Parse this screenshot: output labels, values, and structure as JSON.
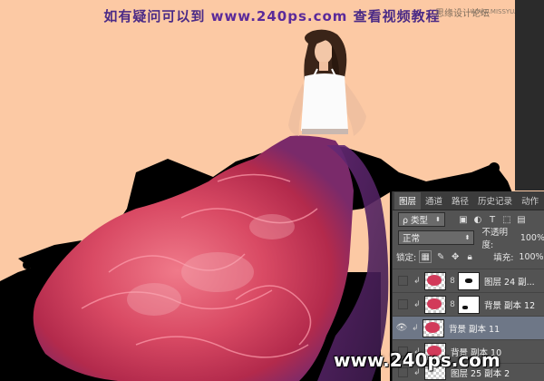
{
  "banner": {
    "prefix": "如有疑问可以到",
    "site": "www.240ps.com",
    "suffix": "查看视频教程"
  },
  "watermarks": {
    "top_right": "思缘设计论坛",
    "top_right_url": "WWW.MISSYUAN.COM",
    "bottom": "www.240ps.com"
  },
  "colors": {
    "background": "#fcc9a4",
    "panel": "#535353",
    "selected_layer": "#6e7787",
    "dress": "#d23a5a",
    "ink": "#000000"
  },
  "panel": {
    "tabs": [
      "图层",
      "通道",
      "路径",
      "历史记录",
      "动作"
    ],
    "active_tab": "图层",
    "filter_kind": "ρ 类型",
    "blend_mode": "正常",
    "opacity_label": "不透明度:",
    "opacity_value": "100%",
    "lock_label": "锁定:",
    "fill_label": "填充:",
    "fill_value": "100%",
    "layers": [
      {
        "name": "图层 24 副...",
        "visible": false,
        "has_mask": true,
        "selected": false
      },
      {
        "name": "背景 副本 12",
        "visible": false,
        "has_mask": true,
        "selected": false
      },
      {
        "name": "背景 副本 11",
        "visible": true,
        "has_mask": false,
        "selected": true
      },
      {
        "name": "背景 副本 10",
        "visible": false,
        "has_mask": false,
        "selected": false
      },
      {
        "name": "图层 25 副本 2",
        "visible": false,
        "has_mask": false,
        "selected": false
      }
    ]
  }
}
